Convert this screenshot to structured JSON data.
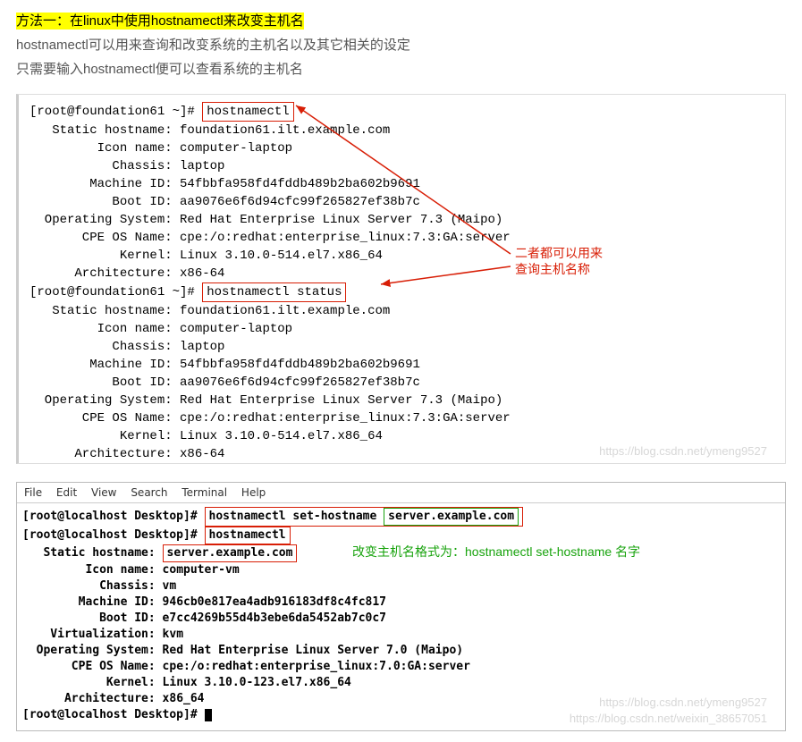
{
  "heading": "方法一：在linux中使用hostnamectl来改变主机名",
  "intro1": "hostnamectl可以用来查询和改变系统的主机名以及其它相关的设定",
  "intro2": "只需要输入hostnamectl便可以查看系统的主机名",
  "term1": {
    "prompt": "[root@foundation61 ~]#",
    "cmd1": "hostnamectl",
    "cmd2": "hostnamectl status",
    "static_hostname_label": "   Static hostname: ",
    "static_hostname": "foundation61.ilt.example.com",
    "icon_name_label": "         Icon name: ",
    "icon_name": "computer-laptop",
    "chassis_label": "           Chassis: ",
    "chassis": "laptop",
    "machine_id_label": "        Machine ID: ",
    "machine_id": "54fbbfa958fd4fddb489b2ba602b9691",
    "boot_id_label": "           Boot ID: ",
    "boot_id": "aa9076e6f6d94cfc99f265827ef38b7c",
    "os_label": "  Operating System: ",
    "os": "Red Hat Enterprise Linux Server 7.3 (Maipo)",
    "cpe_label": "       CPE OS Name: ",
    "cpe": "cpe:/o:redhat:enterprise_linux:7.3:GA:server",
    "kernel_label": "            Kernel: ",
    "kernel": "Linux 3.10.0-514.el7.x86_64",
    "arch_label": "      Architecture: ",
    "arch": "x86-64"
  },
  "annot1_line1": "二者都可以用来",
  "annot1_line2": "查询主机名称",
  "term2": {
    "menu": {
      "file": "File",
      "edit": "Edit",
      "view": "View",
      "search": "Search",
      "terminal": "Terminal",
      "help": "Help"
    },
    "prompt": "[root@localhost Desktop]#",
    "cmd_set": "hostnamectl set-hostname",
    "new_hostname": "server.example.com",
    "cmd_show": "hostnamectl",
    "static_hostname_label": "   Static hostname: ",
    "static_hostname": "server.example.com",
    "icon_name_label": "         Icon name: ",
    "icon_name": "computer-vm",
    "chassis_label": "           Chassis: ",
    "chassis": "vm",
    "machine_id_label": "        Machine ID: ",
    "machine_id": "946cb0e817ea4adb916183df8c4fc817",
    "boot_id_label": "           Boot ID: ",
    "boot_id": "e7cc4269b55d4b3ebe6da5452ab7c0c7",
    "virt_label": "    Virtualization: ",
    "virt": "kvm",
    "os_label": "  Operating System: ",
    "os": "Red Hat Enterprise Linux Server 7.0 (Maipo)",
    "cpe_label": "       CPE OS Name: ",
    "cpe": "cpe:/o:redhat:enterprise_linux:7.0:GA:server",
    "kernel_label": "            Kernel: ",
    "kernel": "Linux 3.10.0-123.el7.x86_64",
    "arch_label": "      Architecture: ",
    "arch": "x86_64"
  },
  "annot2": "改变主机名格式为：hostnamectl set-hostname 名字",
  "watermark1": "https://blog.csdn.net/ymeng9527",
  "watermark2": "https://blog.csdn.net/ymeng9527",
  "watermark3": "https://blog.csdn.net/weixin_38657051"
}
